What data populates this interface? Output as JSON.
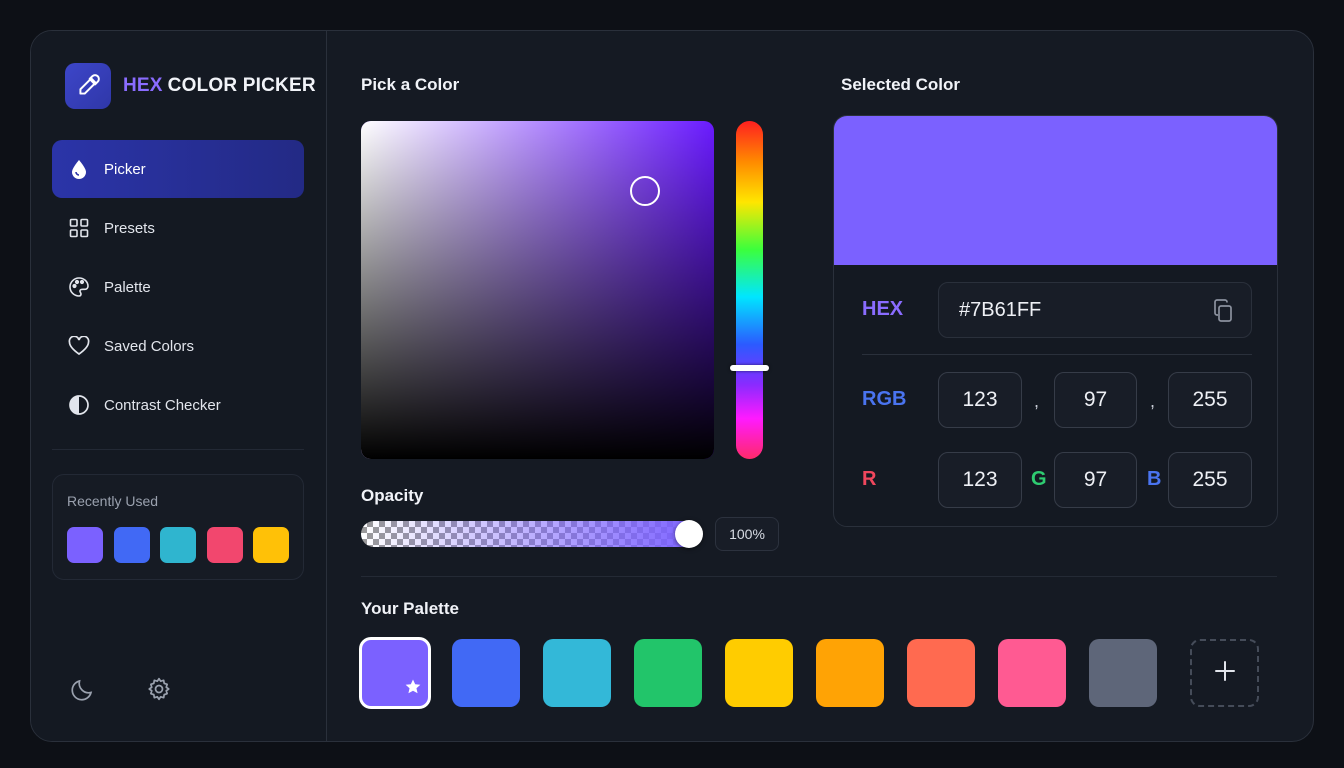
{
  "app": {
    "logo_icon": "eyedropper-icon",
    "title_hex": "HEX",
    "title_rest": "COLOR PICKER"
  },
  "sidebar": {
    "items": [
      {
        "label": "Picker",
        "icon": "droplet-icon",
        "active": true
      },
      {
        "label": "Presets",
        "icon": "grid-icon",
        "active": false
      },
      {
        "label": "Palette",
        "icon": "palette-icon",
        "active": false
      },
      {
        "label": "Saved Colors",
        "icon": "heart-icon",
        "active": false
      },
      {
        "label": "Contrast Checker",
        "icon": "contrast-icon",
        "active": false
      }
    ],
    "recent": {
      "title": "Recently Used",
      "colors": [
        "#7b61ff",
        "#4169f5",
        "#2fb5cf",
        "#f2476e",
        "#ffc107"
      ]
    },
    "bottom_icons": [
      "moon-icon",
      "gear-icon"
    ]
  },
  "picker": {
    "title": "Pick a Color",
    "hue_color": "#6a1bff",
    "opacity_label": "Opacity",
    "opacity_value": "100%",
    "opacity_level": 1.0
  },
  "selected": {
    "title": "Selected Color",
    "color": "#7b61ff",
    "hex_label": "HEX",
    "hex_value": "#7B61FF",
    "rgb_label": "RGB",
    "rgb": {
      "r": "123",
      "g": "97",
      "b": "255"
    },
    "comma": ",",
    "channels": {
      "r_label": "R",
      "g_label": "G",
      "b_label": "B"
    },
    "label_colors": {
      "hex": "#8a6cff",
      "rgb": "#4a74f0",
      "r": "#f0475d",
      "g": "#2ecc71",
      "b": "#4a74f0"
    }
  },
  "palette": {
    "title": "Your Palette",
    "colors": [
      "#7b61ff",
      "#4169f5",
      "#33b8d8",
      "#22c56a",
      "#ffcc00",
      "#ffa305",
      "#ff6a50",
      "#ff5a92",
      "#5e6679"
    ],
    "selected_index": 0,
    "add_icon": "plus-icon"
  }
}
